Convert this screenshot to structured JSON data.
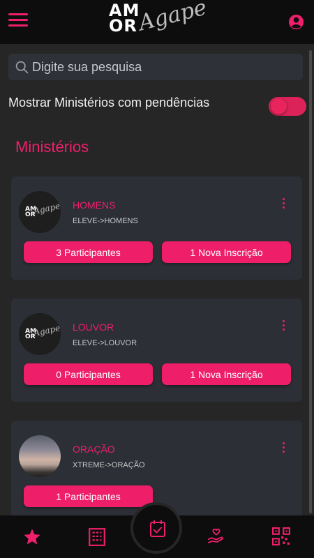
{
  "search": {
    "placeholder": "Digite sua pesquisa"
  },
  "filter": {
    "label": "Mostrar Ministérios com pendências",
    "enabled": true
  },
  "section_title": "Ministérios",
  "ministries": [
    {
      "name": "HOMENS",
      "path": "ELEVE->HOMENS",
      "participants_label": "3 Participantes",
      "inscriptions_label": "1 Nova Inscrição"
    },
    {
      "name": "LOUVOR",
      "path": "ELEVE->LOUVOR",
      "participants_label": "0 Participantes",
      "inscriptions_label": "1 Nova Inscrição"
    },
    {
      "name": "ORAÇÃO",
      "path": "XTREME->ORAÇÃO",
      "participants_label": "1 Participantes"
    }
  ],
  "logo": {
    "block_text": "AM OR",
    "script_text": "Agape"
  },
  "avatar_logo": {
    "block_text": "AM OR",
    "script_text": "Agape"
  },
  "colors": {
    "accent": "#ef1f6b",
    "background": "#262626",
    "card": "#2c2f36",
    "bar": "#0d0d0d"
  },
  "nav": {
    "items": [
      {
        "icon": "star-icon"
      },
      {
        "icon": "building-icon"
      },
      {
        "icon": "calendar-check-icon",
        "active": true
      },
      {
        "icon": "hand-heart-icon"
      },
      {
        "icon": "qr-code-icon"
      }
    ]
  }
}
